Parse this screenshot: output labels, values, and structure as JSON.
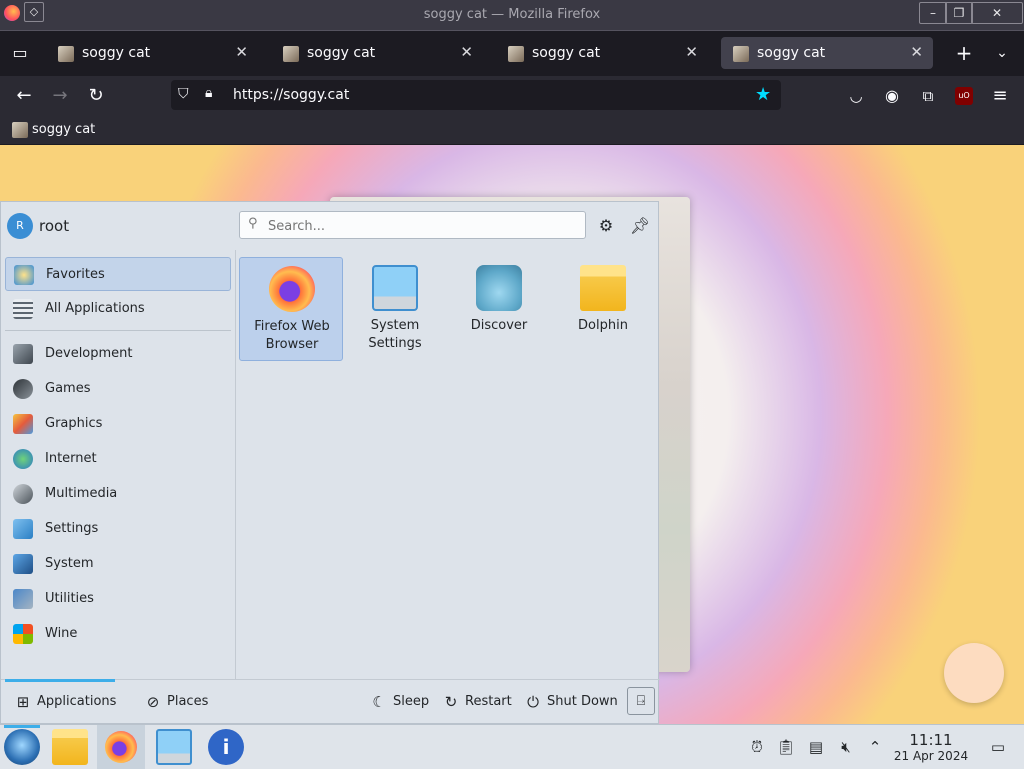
{
  "window": {
    "title": "soggy cat — Mozilla Firefox"
  },
  "tabs": [
    {
      "label": "soggy cat",
      "active": false
    },
    {
      "label": "soggy cat",
      "active": false
    },
    {
      "label": "soggy cat",
      "active": false
    },
    {
      "label": "soggy cat",
      "active": true
    }
  ],
  "nav": {
    "url": "https://soggy.cat"
  },
  "bookmarks": [
    {
      "label": "soggy cat"
    }
  ],
  "launcher": {
    "user": {
      "initial": "R",
      "name": "root"
    },
    "search_placeholder": "Search...",
    "categories": [
      {
        "label": "Favorites",
        "selected": true
      },
      {
        "label": "All Applications"
      },
      {
        "label": "Development"
      },
      {
        "label": "Games"
      },
      {
        "label": "Graphics"
      },
      {
        "label": "Internet"
      },
      {
        "label": "Multimedia"
      },
      {
        "label": "Settings"
      },
      {
        "label": "System"
      },
      {
        "label": "Utilities"
      },
      {
        "label": "Wine"
      }
    ],
    "apps": [
      {
        "label": "Firefox Web Browser",
        "icon": "firefox-icon",
        "selected": true
      },
      {
        "label": "System Settings",
        "icon": "system-settings-icon"
      },
      {
        "label": "Discover",
        "icon": "discover-icon"
      },
      {
        "label": "Dolphin",
        "icon": "dolphin-folder-icon"
      }
    ],
    "footer": {
      "applications": "Applications",
      "places": "Places",
      "sleep": "Sleep",
      "restart": "Restart",
      "shutdown": "Shut Down"
    }
  },
  "taskbar": {
    "time": "11:11",
    "date": "21 Apr 2024"
  },
  "colors": {
    "accent": "#3daee9",
    "selection": "#c3d4ea",
    "firefox_dark": "#2b2a33"
  }
}
